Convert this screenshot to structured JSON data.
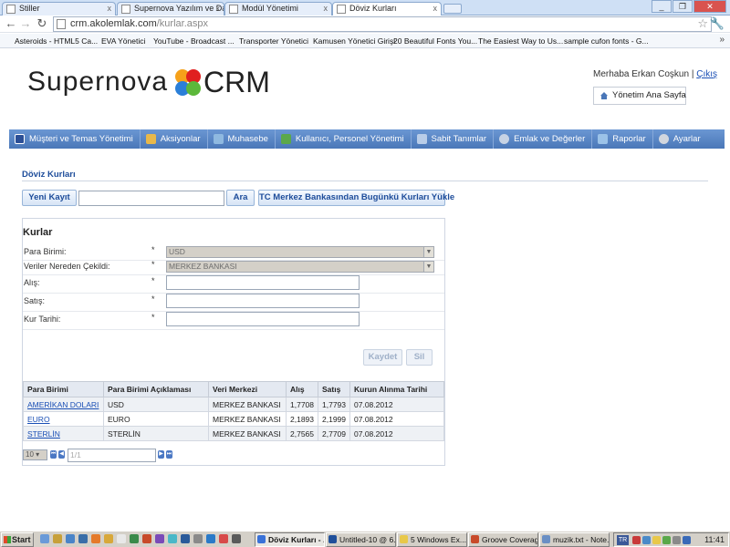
{
  "browser": {
    "tabs": [
      {
        "label": "Stiller",
        "active": false
      },
      {
        "label": "Supernova Yazılım ve Danışm",
        "active": false
      },
      {
        "label": "Modül Yönetimi",
        "active": false
      },
      {
        "label": "Döviz Kurları",
        "active": true
      }
    ],
    "url_host": "crm.akolemlak.com",
    "url_path": "/kurlar.aspx",
    "bookmarks": [
      {
        "label": "Asteroids - HTML5 Ca...",
        "icon_color": "#3a3a3a"
      },
      {
        "label": "EVA Yönetici",
        "icon_color": "#ffffff"
      },
      {
        "label": "YouTube - Broadcast ...",
        "icon_color": "#d7261c"
      },
      {
        "label": "Transporter Yönetici",
        "icon_color": "#ffffff"
      },
      {
        "label": "Kamusen Yönetici Girişi",
        "icon_color": "#8a57a8"
      },
      {
        "label": "20 Beautiful Fonts You...",
        "icon_color": "#222222"
      },
      {
        "label": "The Easiest Way to Us...",
        "icon_color": "#2f8a3a"
      },
      {
        "label": "sample cufon fonts - G...",
        "icon_color": "#3a72d8"
      }
    ],
    "bookmarks_more": "»"
  },
  "header": {
    "logo_left": "Supernova",
    "logo_right": "CRM",
    "greeting": "Merhaba Erkan Coşkun |",
    "logout": "Çıkış",
    "home_link": "Yönetim Ana Sayfa"
  },
  "menu": [
    {
      "label": "Müşteri ve Temas Yönetimi",
      "icon_color": "#2b4f96"
    },
    {
      "label": "Aksiyonlar",
      "icon_color": "#e8b84a"
    },
    {
      "label": "Muhasebe",
      "icon_color": "#8fb9e0"
    },
    {
      "label": "Kullanıcı, Personel Yönetimi",
      "icon_color": "#5ba84a"
    },
    {
      "label": "Sabit Tanımlar",
      "icon_color": "#b9cde8"
    },
    {
      "label": "Emlak ve Değerler",
      "icon_color": "#c7d3e4"
    },
    {
      "label": "Raporlar",
      "icon_color": "#9bc2e8"
    },
    {
      "label": "Ayarlar",
      "icon_color": "#d1d6de"
    }
  ],
  "page": {
    "title": "Döviz Kurları",
    "new_record_button": "Yeni Kayıt",
    "search_value": "",
    "search_button": "Ara",
    "load_button": "TC Merkez Bankasından Bugünkü Kurları Yükle"
  },
  "form": {
    "title": "Kurlar",
    "required_mark": "*",
    "fields": {
      "currency_label": "Para Birimi:",
      "currency_value": "USD",
      "source_label": "Veriler Nereden Çekildi:",
      "source_value": "MERKEZ BANKASI",
      "buy_label": "Alış:",
      "buy_value": "",
      "sell_label": "Satış:",
      "sell_value": "",
      "date_label": "Kur Tarihi:",
      "date_value": ""
    },
    "save_button": "Kaydet",
    "delete_button": "Sil"
  },
  "table": {
    "headers": [
      "Para Birimi",
      "Para Birimi Açıklaması",
      "Veri Merkezi",
      "Alış",
      "Satış",
      "Kurun Alınma Tarihi"
    ],
    "rows": [
      [
        "AMERİKAN DOLARI",
        "USD",
        "MERKEZ BANKASI",
        "1,7708",
        "1,7793",
        "07.08.2012"
      ],
      [
        "EURO",
        "EURO",
        "MERKEZ BANKASI",
        "2,1893",
        "2,1999",
        "07.08.2012"
      ],
      [
        "STERLİN",
        "STERLİN",
        "MERKEZ BANKASI",
        "2,7565",
        "2,7709",
        "07.08.2012"
      ]
    ]
  },
  "pager": {
    "page_size": "10",
    "first": "⏮",
    "prev": "◀",
    "page_value": "1/1",
    "next": "▶",
    "last": "⏭"
  },
  "taskbar": {
    "start": "Start",
    "tasks": [
      {
        "label": "Döviz Kurları - ...",
        "active": true,
        "icon_color": "#3a72d8"
      },
      {
        "label": "Untitled-10 @ 6...",
        "active": false,
        "icon_color": "#1f4f9a"
      },
      {
        "label": "5 Windows Ex...",
        "active": false,
        "icon_color": "#e8c84a"
      },
      {
        "label": "Groove Coverag...",
        "active": false,
        "icon_color": "#c84a2a"
      },
      {
        "label": "muzik.txt - Note...",
        "active": false,
        "icon_color": "#6a8fc4"
      }
    ],
    "lang": "TR",
    "clock": "11:41"
  }
}
